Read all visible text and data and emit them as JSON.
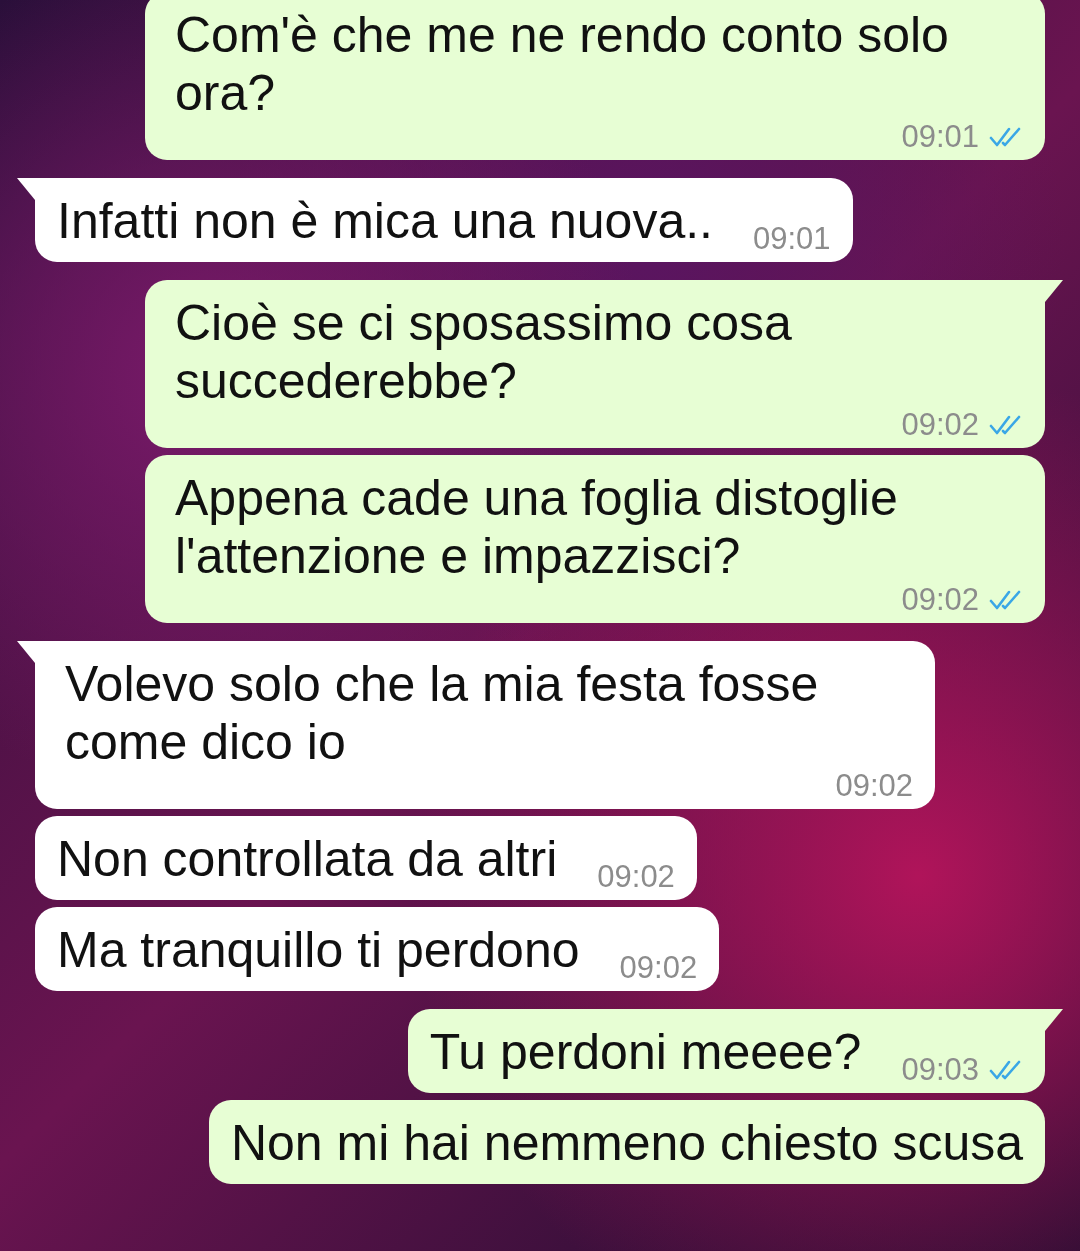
{
  "messages": [
    {
      "kind": "outgoing",
      "tail": false,
      "text": "Com'è che me ne rendo conto solo ora?",
      "time": "09:01",
      "read": true
    },
    {
      "kind": "incoming",
      "tail": true,
      "text": "Infatti non è mica una nuova..",
      "time": "09:01"
    },
    {
      "kind": "outgoing",
      "tail": true,
      "text": "Cioè se ci sposassimo cosa succederebbe?",
      "time": "09:02",
      "read": true
    },
    {
      "kind": "outgoing",
      "tail": false,
      "text": "Appena cade una foglia distoglie l'attenzione e impazzisci?",
      "time": "09:02",
      "read": true
    },
    {
      "kind": "incoming",
      "tail": true,
      "text": "Volevo solo che la mia festa fosse come dico io",
      "time": "09:02"
    },
    {
      "kind": "incoming",
      "tail": false,
      "text": "Non controllata da altri",
      "time": "09:02"
    },
    {
      "kind": "incoming",
      "tail": false,
      "text": "Ma tranquillo ti perdono",
      "time": "09:02"
    },
    {
      "kind": "outgoing",
      "tail": true,
      "text": "Tu perdoni meeee?",
      "time": "09:03",
      "read": true
    },
    {
      "kind": "outgoing",
      "tail": false,
      "text": "Non mi hai nemmeno chiesto scusa"
    }
  ]
}
